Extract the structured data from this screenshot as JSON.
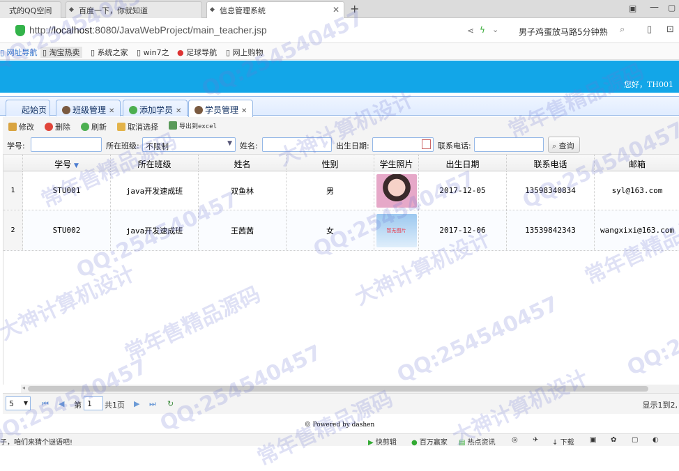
{
  "browser": {
    "tabs": [
      {
        "label": "式的QQ空间"
      },
      {
        "label": "百度一下，你就知道"
      },
      {
        "label": "信息管理系统"
      }
    ],
    "new_tab": "+",
    "url_prefix": "http://",
    "url_host": "localhost",
    "url_rest": ":8080/JavaWebProject/main_teacher.jsp",
    "search_text": "男子鸡蛋放马路5分钟熟",
    "bookmarks": [
      "网址导航",
      "淘宝热卖",
      "系统之家",
      "win7之",
      "足球导航",
      "网上购物"
    ]
  },
  "app": {
    "greeting": "您好，TH001",
    "tabs": [
      {
        "label": "起始页",
        "closable": false
      },
      {
        "label": "班级管理",
        "closable": true
      },
      {
        "label": "添加学员",
        "closable": true
      },
      {
        "label": "学员管理",
        "closable": true
      }
    ],
    "toolbar": {
      "edit": "修改",
      "delete": "删除",
      "refresh": "刷新",
      "cancel_select": "取消选择",
      "export": "导出到excel"
    },
    "filter": {
      "student_no_label": "学号:",
      "class_label": "所在班级:",
      "class_value": "不限制",
      "name_label": "姓名:",
      "birth_label": "出生日期:",
      "phone_label": "联系电话:",
      "query": "查询"
    },
    "grid": {
      "columns": [
        "学号",
        "所在班级",
        "姓名",
        "性别",
        "学生照片",
        "出生日期",
        "联系电话",
        "邮箱"
      ],
      "rows": [
        {
          "n": "1",
          "no": "STU001",
          "cls": "java开发速成班",
          "name": "双鱼林",
          "sex": "男",
          "photo": "",
          "birth": "2017-12-05",
          "phone": "13598340834",
          "email": "syl@163.com"
        },
        {
          "n": "2",
          "no": "STU002",
          "cls": "java开发速成班",
          "name": "王茜茜",
          "sex": "女",
          "photo": "暂无图片",
          "birth": "2017-12-06",
          "phone": "13539842343",
          "email": "wangxixi@163.com"
        }
      ]
    },
    "pager": {
      "page_size": "5",
      "page_prefix": "第",
      "page_value": "1",
      "page_suffix": "共1页",
      "info": "显示1到2,"
    },
    "footer": "© Powered by dashen"
  },
  "statusbar": {
    "left": "子，咱们来猜个谜语吧!",
    "items": [
      "快剪辑",
      "百万赢家",
      "热点资讯",
      "下载"
    ]
  },
  "watermarks": [
    "QQ:254540457",
    "常年售精品源码",
    "大神计算机设计"
  ],
  "colors": {
    "header": "#12a6e8",
    "tab_border": "#95b8e7"
  }
}
